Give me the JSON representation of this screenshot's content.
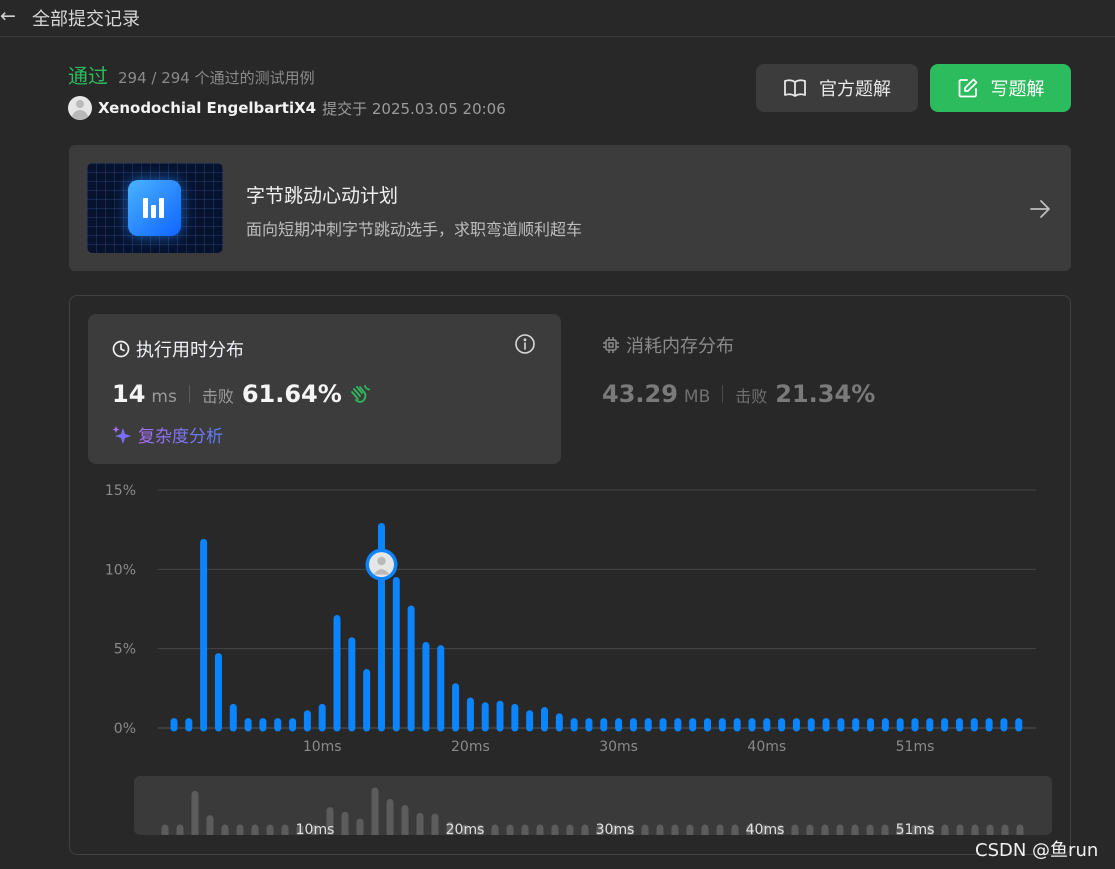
{
  "header": {
    "back_icon": "arrow-left-icon",
    "title": "全部提交记录"
  },
  "result": {
    "status": "通过",
    "cases": "294 / 294 个通过的测试用例",
    "username": "Xenodochial EngelbartiX4",
    "submitted_at": "提交于 2025.03.05 20:06"
  },
  "actions": {
    "official_solution": "官方题解",
    "write_solution": "写题解"
  },
  "banner": {
    "title": "字节跳动心动计划",
    "subtitle": "面向短期冲刺字节跳动选手，求职弯道顺利超车"
  },
  "runtime": {
    "title": "执行用时分布",
    "value": "14",
    "unit": "ms",
    "beat_label": "击败",
    "percent": "61.64%",
    "complexity_link": "复杂度分析"
  },
  "memory": {
    "title": "消耗内存分布",
    "value": "43.29",
    "unit": "MB",
    "beat_label": "击败",
    "percent": "21.34%"
  },
  "colors": {
    "accent_green": "#2cbb5d",
    "bar_blue": "#0a84ff",
    "mini_bar": "#5c5c5c"
  },
  "chart_data": {
    "type": "bar",
    "ylim": [
      0,
      15
    ],
    "yticks": [
      "0%",
      "5%",
      "10%",
      "15%"
    ],
    "xtick_labels": [
      "10ms",
      "20ms",
      "30ms",
      "40ms",
      "51ms"
    ],
    "xtick_positions": [
      10,
      20,
      30,
      40,
      50
    ],
    "x": [
      0,
      1,
      2,
      3,
      4,
      5,
      6,
      7,
      8,
      9,
      10,
      11,
      12,
      13,
      14,
      15,
      16,
      17,
      18,
      19,
      20,
      21,
      22,
      23,
      24,
      25,
      26,
      27,
      28,
      29,
      30,
      31,
      32,
      33,
      34,
      35,
      36,
      37,
      38,
      39,
      40,
      41,
      42,
      43,
      44,
      45,
      46,
      47,
      48,
      49,
      50,
      51,
      52,
      53,
      54,
      55,
      56,
      57
    ],
    "values": [
      0.4,
      0.4,
      11.7,
      4.5,
      1.3,
      0.4,
      0.4,
      0.4,
      0.4,
      0.9,
      1.3,
      6.9,
      5.5,
      3.5,
      12.7,
      9.3,
      7.5,
      5.2,
      5.0,
      2.6,
      1.7,
      1.4,
      1.5,
      1.3,
      0.9,
      1.1,
      0.7,
      0.4,
      0.4,
      0.4,
      0.4,
      0.4,
      0.4,
      0.4,
      0.4,
      0.4,
      0.4,
      0.4,
      0.4,
      0.4,
      0.4,
      0.4,
      0.4,
      0.4,
      0.4,
      0.4,
      0.4,
      0.4,
      0.4,
      0.4,
      0.4,
      0.4,
      0.4,
      0.4,
      0.4,
      0.4,
      0.4,
      0.4
    ],
    "highlight_x": 14,
    "grid": true
  },
  "watermark": "CSDN @鱼run"
}
